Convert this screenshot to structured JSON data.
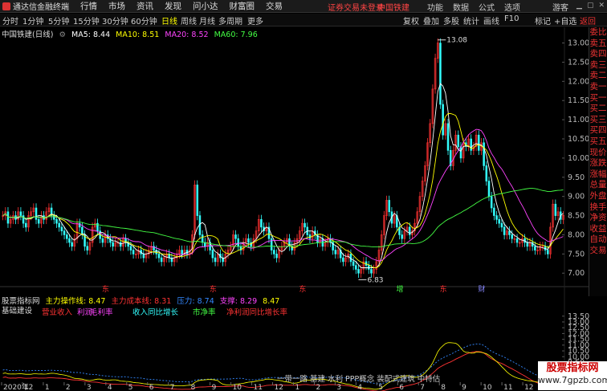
{
  "app": {
    "name": "通达信金融终端",
    "menu": [
      "行情",
      "市场",
      "资讯",
      "发现",
      "问小达",
      "财富圈",
      "交易"
    ],
    "notice": "证券交易未登录",
    "stock_name": "中国铁建",
    "right_menu": [
      "功能",
      "数据",
      "公式",
      "选项"
    ],
    "guest": "游客"
  },
  "toolbar": {
    "periods": [
      "分时",
      "1分钟",
      "5分钟",
      "15分钟",
      "30分钟",
      "60分钟",
      "日线",
      "周线",
      "月线",
      "多周期",
      "更多"
    ],
    "active": "日线",
    "buttons": [
      "复权",
      "叠加",
      "多股",
      "统计",
      "画线",
      "F10",
      "标记",
      "+自选",
      "返回"
    ]
  },
  "chart_header": {
    "title": "中国铁建(日线)",
    "ma": [
      {
        "label": "MA5: 8.44",
        "color": "#ffffff"
      },
      {
        "label": "MA10: 8.51",
        "color": "#ffff00"
      },
      {
        "label": "MA20: 8.52",
        "color": "#ff44ff"
      },
      {
        "label": "MA60: 7.96",
        "color": "#44ff44"
      }
    ]
  },
  "side_panel": [
    "委比",
    "卖五",
    "卖四",
    "卖三",
    "卖二",
    "卖一",
    "买一",
    "买二",
    "买三",
    "买四",
    "买五",
    "现价",
    "涨跌",
    "涨幅",
    "总量",
    "外盘",
    "换手",
    "净资",
    "收益",
    "自动",
    "交易"
  ],
  "price_axis": {
    "ticks": [
      "13.00",
      "12.50",
      "12.00",
      "11.50",
      "11.00",
      "10.50",
      "10.00",
      "9.50",
      "9.00",
      "8.50",
      "8.00",
      "7.50",
      "7.00"
    ],
    "ymin": 6.9,
    "ymax": 13.2
  },
  "annotations": {
    "high": "13.08",
    "low": "6.83"
  },
  "markers": [
    "东",
    "东",
    "东",
    "增",
    "东",
    "财"
  ],
  "indicator": {
    "name": "股票指标网",
    "line1": "主力操作线: 8.47",
    "line2": "主力成本线: 8.31",
    "line3": "压力: 8.74",
    "line4": "支撑: 8.29",
    "line5": "8.47",
    "basics": "基础建设",
    "labels": [
      "营业收入",
      "利润",
      "毛利率",
      "收入同比增长",
      "市净率",
      "净利润同比增长率"
    ],
    "ticks": [
      "13.50",
      "13.00",
      "12.50",
      "12.00",
      "11.50",
      "11.00",
      "10.50",
      "10.00",
      "9.50",
      "9.00",
      "8.50",
      "8.00"
    ],
    "ymin": 7.8,
    "ymax": 13.9
  },
  "time_axis": [
    "2020年",
    "12",
    "1",
    "2",
    "3",
    "4",
    "5",
    "6",
    "7",
    "8",
    "9",
    "10",
    "11",
    "12",
    "1",
    "2",
    "3",
    "4",
    "5",
    "6",
    "7",
    "8",
    "9",
    "10",
    "11",
    "12",
    "1"
  ],
  "concept": "一带一路 基建 水利 PPP概念 装配式建筑 中特估",
  "watermark": {
    "line1": "股票指标网",
    "line2": "www.7gpzb.com"
  },
  "colors": {
    "up": "#ff3333",
    "down": "#33ffff",
    "ma5": "#ffffff",
    "ma10": "#ffff00",
    "ma20": "#ff44ff",
    "ma60": "#44ff44"
  },
  "chart_data": {
    "type": "candlestick",
    "ymin": 6.9,
    "ymax": 13.2,
    "close": [
      8.5,
      8.6,
      8.3,
      8.4,
      8.5,
      8.4,
      8.6,
      8.5,
      8.3,
      8.2,
      8.5,
      8.6,
      8.7,
      8.4,
      8.3,
      8.5,
      8.4,
      8.6,
      8.7,
      8.5,
      8.4,
      8.3,
      8.2,
      8.1,
      8.0,
      7.9,
      7.8,
      7.7,
      7.9,
      8.3,
      8.2,
      8.0,
      7.7,
      7.6,
      7.8,
      8.2,
      8.3,
      8.1,
      7.9,
      7.8,
      8.0,
      7.9,
      7.8,
      7.7,
      7.8,
      7.8,
      7.7,
      7.9,
      7.8,
      7.7,
      7.6,
      7.5,
      7.5,
      7.6,
      7.5,
      7.4,
      7.5,
      7.6,
      7.7,
      7.6,
      7.5,
      7.4,
      7.3,
      7.4,
      7.5,
      7.4,
      7.3,
      7.4,
      7.5,
      7.6,
      7.5,
      7.6,
      7.5,
      7.6,
      8.0,
      9.3,
      8.5,
      8.0,
      7.8,
      7.7,
      7.8,
      7.6,
      7.4,
      7.3,
      7.5,
      7.4,
      7.3,
      7.5,
      7.6,
      7.7,
      8.0,
      7.9,
      7.7,
      7.6,
      7.8,
      7.9,
      7.8,
      7.7,
      7.9,
      8.1,
      8.4,
      8.2,
      8.1,
      8.2,
      7.9,
      7.6,
      7.5,
      7.4,
      7.6,
      7.7,
      7.8,
      7.9,
      7.7,
      7.6,
      7.8,
      7.9,
      8.1,
      8.3,
      8.2,
      8.0,
      7.9,
      8.1,
      8.0,
      7.8,
      7.9,
      7.7,
      7.8,
      7.9,
      7.8,
      7.6,
      7.5,
      7.6,
      7.4,
      7.3,
      7.4,
      7.5,
      7.3,
      7.2,
      7.1,
      7.0,
      7.1,
      7.3,
      7.2,
      7.1,
      7.0,
      7.1,
      7.3,
      7.6,
      8.0,
      8.5,
      8.9,
      8.6,
      8.3,
      8.5,
      8.2,
      8.0,
      7.9,
      8.1,
      8.2,
      8.0,
      8.1,
      8.3,
      8.6,
      9.0,
      9.4,
      9.8,
      10.4,
      10.9,
      11.8,
      12.6,
      13.0,
      11.4,
      10.6,
      10.9,
      10.2,
      9.8,
      10.2,
      10.6,
      10.3,
      10.0,
      10.4,
      10.3,
      10.5,
      10.2,
      10.3,
      10.6,
      10.2,
      10.4,
      9.8,
      9.4,
      9.0,
      8.7,
      8.5,
      8.4,
      8.3,
      8.2,
      8.0,
      8.1,
      8.0,
      7.9,
      7.9,
      7.8,
      7.8,
      7.9,
      7.8,
      7.7,
      7.8,
      7.7,
      7.6,
      7.6,
      7.7,
      7.7,
      7.6,
      7.5,
      8.2,
      8.8,
      8.5,
      8.6,
      8.4,
      8.5
    ]
  }
}
